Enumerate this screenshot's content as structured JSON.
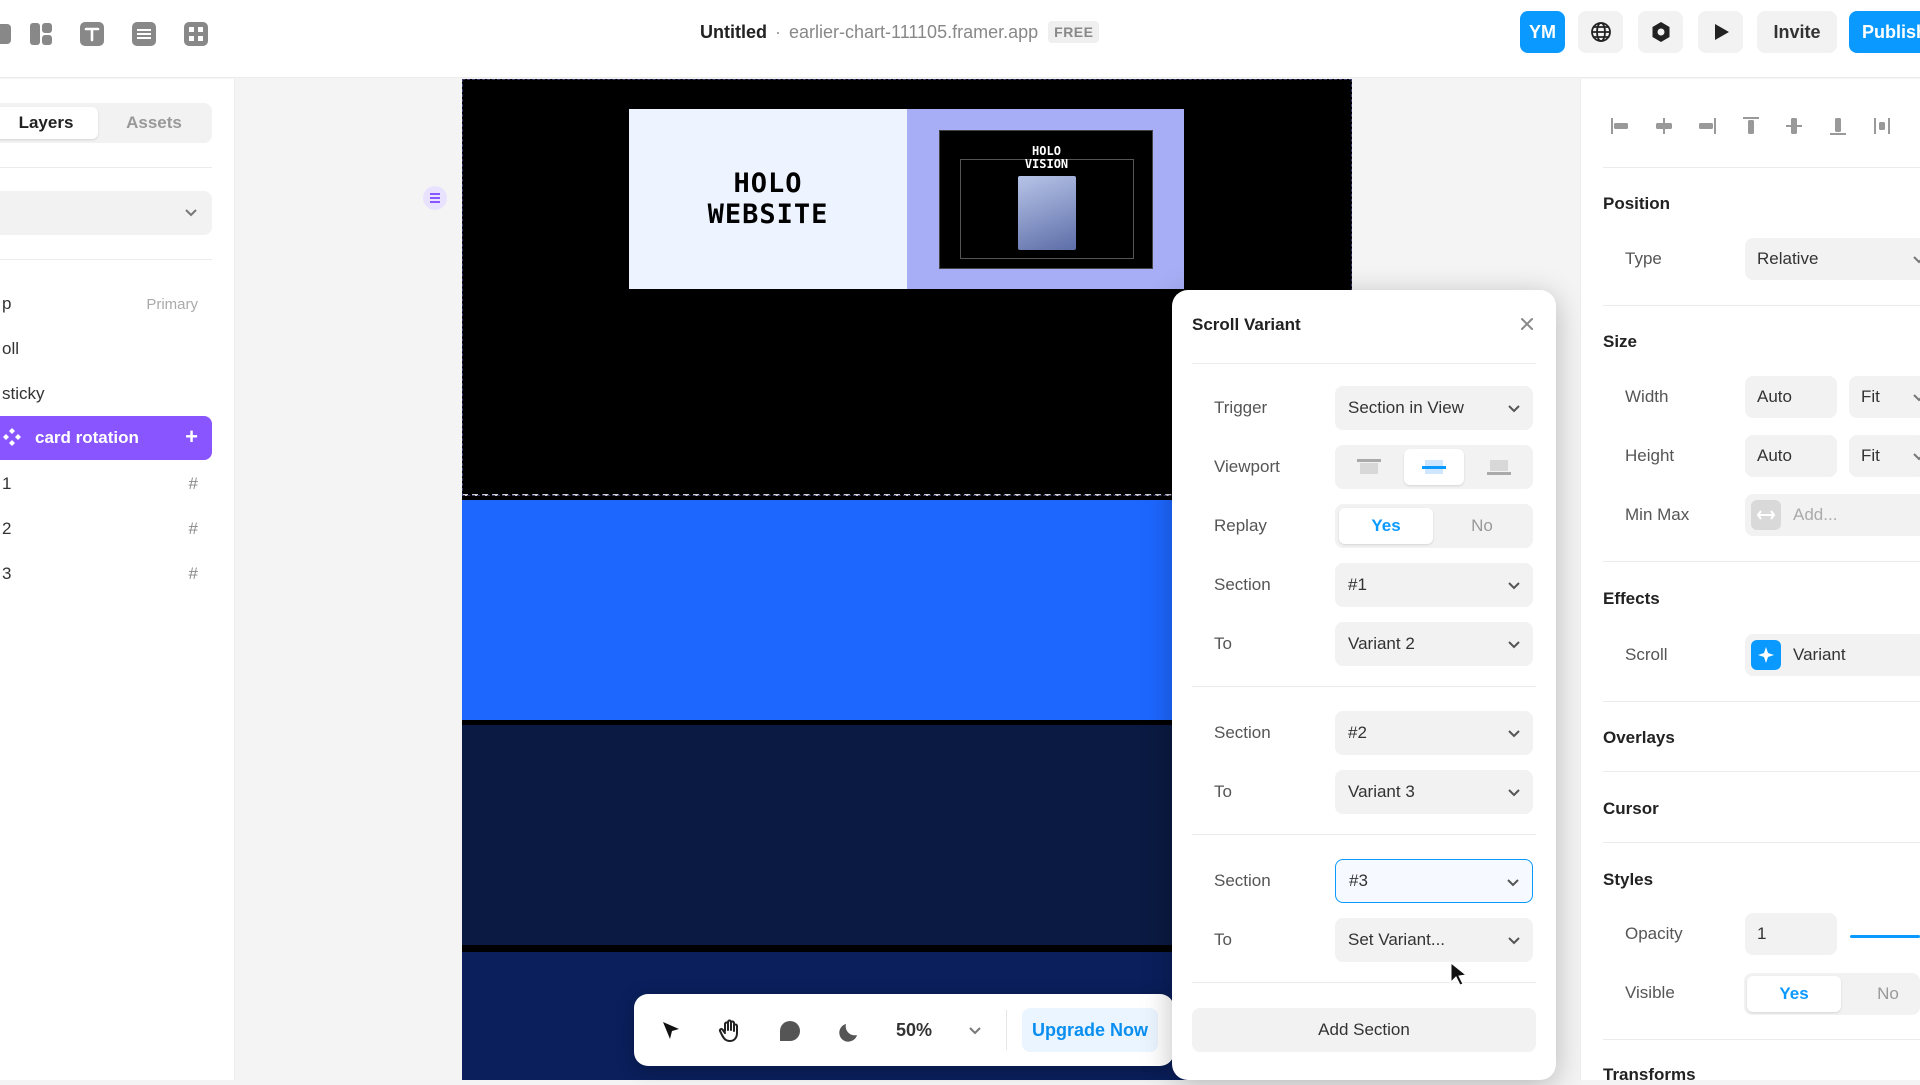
{
  "topbar": {
    "title": "Untitled",
    "separator": "·",
    "domain": "earlier-chart-111105.framer.app",
    "plan_badge": "FREE",
    "avatar_initials": "YM",
    "invite_label": "Invite",
    "publish_label": "Publish",
    "icons": [
      "layout-icon",
      "text-icon",
      "cms-icon",
      "components-icon",
      "globe-icon",
      "settings-icon",
      "play-icon"
    ]
  },
  "left_panel": {
    "tabs": [
      {
        "label": "Layers",
        "active": true
      },
      {
        "label": "Assets",
        "active": false
      }
    ],
    "layers": [
      {
        "name": "p",
        "tag": "Primary"
      },
      {
        "name": "oll"
      },
      {
        "name": " sticky"
      },
      {
        "name": "card rotation",
        "selected": true
      },
      {
        "name": " 1",
        "icon": "#"
      },
      {
        "name": " 2",
        "icon": "#"
      },
      {
        "name": " 3",
        "icon": "#"
      }
    ]
  },
  "canvas": {
    "hero_text": "HOLO\nWEBSITE",
    "mini_title": "HOLO\nVISION",
    "colors": {
      "blue_section": "#1d67ff",
      "navy_section": "#0b1a42",
      "accent": "#8855ff"
    }
  },
  "bottom_toolbar": {
    "zoom": "50%",
    "upgrade_label": "Upgrade Now",
    "icons": [
      "cursor-icon",
      "hand-icon",
      "comment-icon",
      "moon-icon"
    ]
  },
  "scroll_variant": {
    "title": "Scroll Variant",
    "trigger_label": "Trigger",
    "trigger_value": "Section in View",
    "viewport_label": "Viewport",
    "viewport_selected": "center",
    "replay_label": "Replay",
    "replay_yes": "Yes",
    "replay_no": "No",
    "groups": [
      {
        "section_label": "Section",
        "section_value": "#1",
        "to_label": "To",
        "to_value": "Variant 2"
      },
      {
        "section_label": "Section",
        "section_value": "#2",
        "to_label": "To",
        "to_value": "Variant 3"
      },
      {
        "section_label": "Section",
        "section_value": "#3",
        "to_label": "To",
        "to_value": "Set Variant..."
      }
    ],
    "add_section_label": "Add Section"
  },
  "right_panel": {
    "position_heading": "Position",
    "type_label": "Type",
    "type_value": "Relative",
    "size_heading": "Size",
    "width_label": "Width",
    "width_value": "Auto",
    "width_mode": "Fit",
    "height_label": "Height",
    "height_value": "Auto",
    "height_mode": "Fit",
    "minmax_label": "Min Max",
    "minmax_placeholder": "Add...",
    "effects_heading": "Effects",
    "scroll_label": "Scroll",
    "scroll_value": "Variant",
    "overlays_heading": "Overlays",
    "cursor_heading": "Cursor",
    "styles_heading": "Styles",
    "opacity_label": "Opacity",
    "opacity_value": "1",
    "visible_label": "Visible",
    "visible_yes": "Yes",
    "visible_no": "No",
    "transforms_heading": "Transforms"
  }
}
